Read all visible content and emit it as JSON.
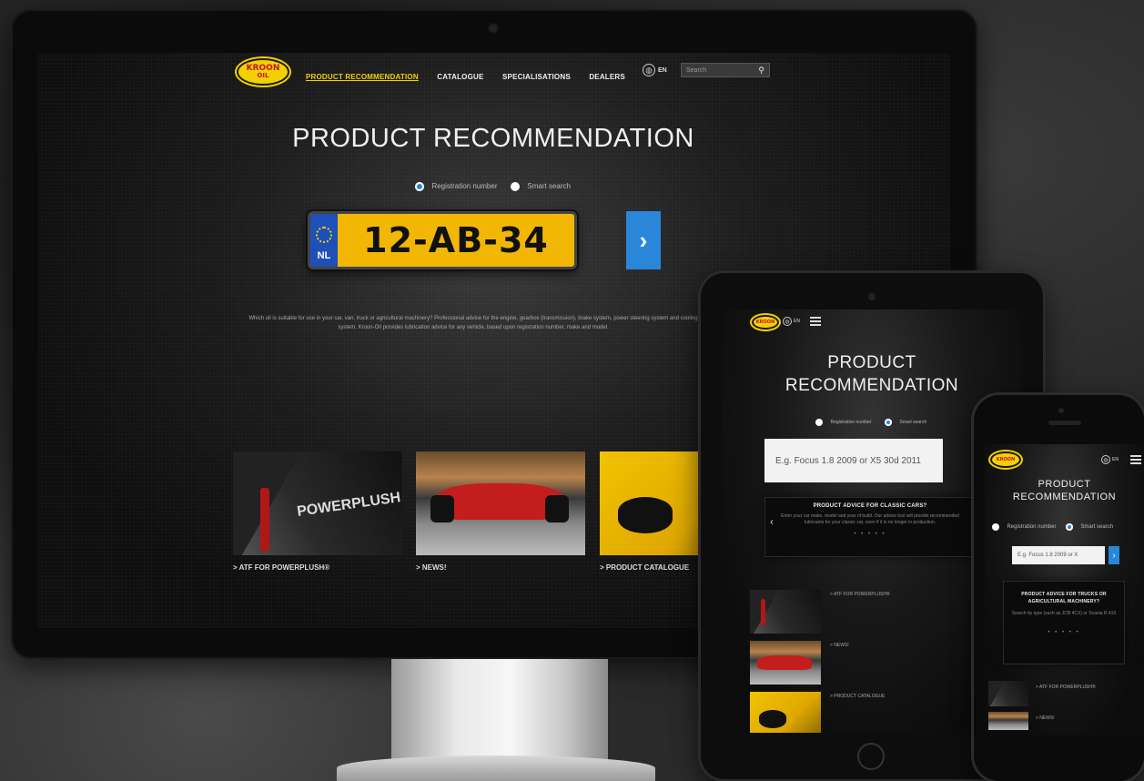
{
  "brand": {
    "logo_top": "KROON",
    "logo_bottom": "OIL"
  },
  "colors": {
    "accent": "#f2d100",
    "blue": "#2a86d8",
    "plate": "#f2b705"
  },
  "desktop": {
    "nav": [
      {
        "label": "PRODUCT RECOMMENDATION",
        "active": true
      },
      {
        "label": "CATALOGUE"
      },
      {
        "label": "SPECIALISATIONS"
      },
      {
        "label": "DEALERS"
      }
    ],
    "language": "EN",
    "search_placeholder": "Search",
    "title": "PRODUCT RECOMMENDATION",
    "radio_registration": "Registration number",
    "radio_smart": "Smart search",
    "plate_country": "NL",
    "plate_number": "12-AB-34",
    "go_icon": "›",
    "description": "Which oil is suitable for use in your car, van, truck or agricultural machinery? Professional advice for the engine, gearbox (transmission), brake system, power steering system and cooling system. Kroon-Oil provides lubrication advice for any vehicle, based upon registration number, make and model.",
    "thumbs": [
      {
        "label": "> ATF FOR POWERPLUSH®",
        "image": "tank-icon",
        "brand": "POWERPLUSH"
      },
      {
        "label": "> NEWS!",
        "image": "f1-car-icon"
      },
      {
        "label": "> PRODUCT CATALOGUE",
        "image": "oil-cap-icon"
      }
    ]
  },
  "tablet": {
    "language": "EN",
    "title_line1": "PRODUCT",
    "title_line2": "RECOMMENDATION",
    "radio_registration": "Registration number",
    "radio_smart": "Smart search",
    "input_placeholder": "E.g. Focus 1.8 2009 or X5 30d 2011",
    "advice_title": "PRODUCT ADVICE FOR CLASSIC CARS?",
    "advice_body": "Enter your car make, model and year of build. Our advice tool will provide recommended lubricants for your classic car, even if it is no longer in production.",
    "prev_icon": "‹",
    "dots": "• • • • •",
    "list": [
      {
        "label": "> ATF FOR POWERPLUSH®"
      },
      {
        "label": "> NEWS!"
      },
      {
        "label": "> PRODUCT CATALOGUE"
      }
    ]
  },
  "phone": {
    "language": "EN",
    "title_line1": "PRODUCT",
    "title_line2": "RECOMMENDATION",
    "radio_registration": "Registration number",
    "radio_smart": "Smart search",
    "input_placeholder": "E.g. Focus 1.8 2009 or X",
    "go_icon": "›",
    "advice_title": "PRODUCT ADVICE FOR TRUCKS OR AGRICULTURAL MACHINERY?",
    "advice_body": "Search by type (such as JCB 4CX) or Scania R 410",
    "dots": "• • • • •",
    "list": [
      {
        "label": "> ATF FOR POWERPLUSH®"
      },
      {
        "label": "> NEWS!"
      }
    ]
  }
}
